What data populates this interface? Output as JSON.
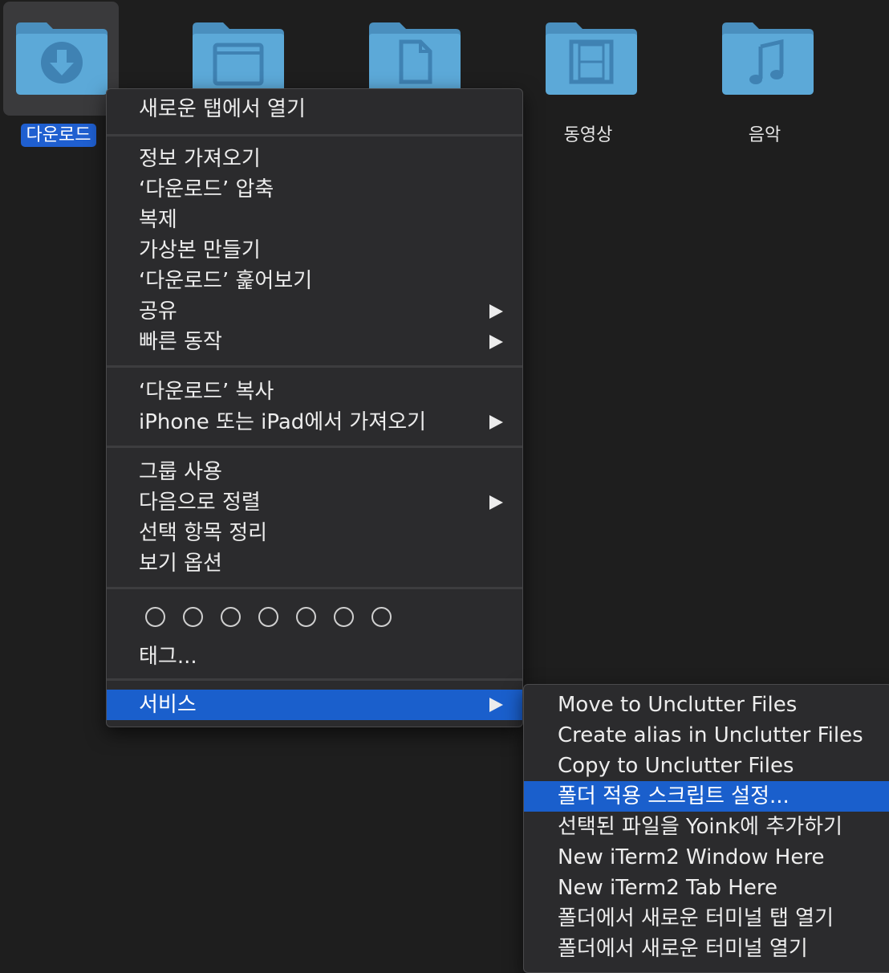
{
  "desktop": {
    "folders": [
      {
        "label": "다운로드",
        "icon": "download-folder-icon",
        "selected": true
      },
      {
        "label": "",
        "icon": "window-folder-icon"
      },
      {
        "label": "",
        "icon": "document-folder-icon"
      },
      {
        "label": "동영상",
        "icon": "movies-folder-icon"
      },
      {
        "label": "음악",
        "icon": "music-folder-icon"
      }
    ]
  },
  "context_menu": {
    "open_new_tab": "새로운 탭에서 열기",
    "get_info": "정보 가져오기",
    "compress": "‘다운로드’ 압축",
    "duplicate": "복제",
    "make_alias": "가상본 만들기",
    "quick_look": "‘다운로드’ 훑어보기",
    "share": "공유",
    "quick_actions": "빠른 동작",
    "copy": "‘다운로드’ 복사",
    "import_iphone": "iPhone 또는 iPad에서 가져오기",
    "use_groups": "그룹 사용",
    "sort_by": "다음으로 정렬",
    "clean_up": "선택 항목 정리",
    "view_options": "보기 옵션",
    "tags": "태그...",
    "services": "서비스"
  },
  "services_menu": {
    "items": [
      "Move to Unclutter Files",
      "Create alias in Unclutter Files",
      "Copy to Unclutter Files",
      "폴더 적용 스크립트 설정...",
      "선택된 파일을 Yoink에 추가하기",
      "New iTerm2 Window Here",
      "New iTerm2 Tab Here",
      "폴더에서 새로운 터미널 탭 열기",
      "폴더에서 새로운 터미널 열기"
    ],
    "highlighted_index": 3
  },
  "colors": {
    "background": "#1e1e1e",
    "menu_bg": "#2b2b2d",
    "highlight": "#1a5fcc",
    "folder": "#5aa6d6"
  }
}
